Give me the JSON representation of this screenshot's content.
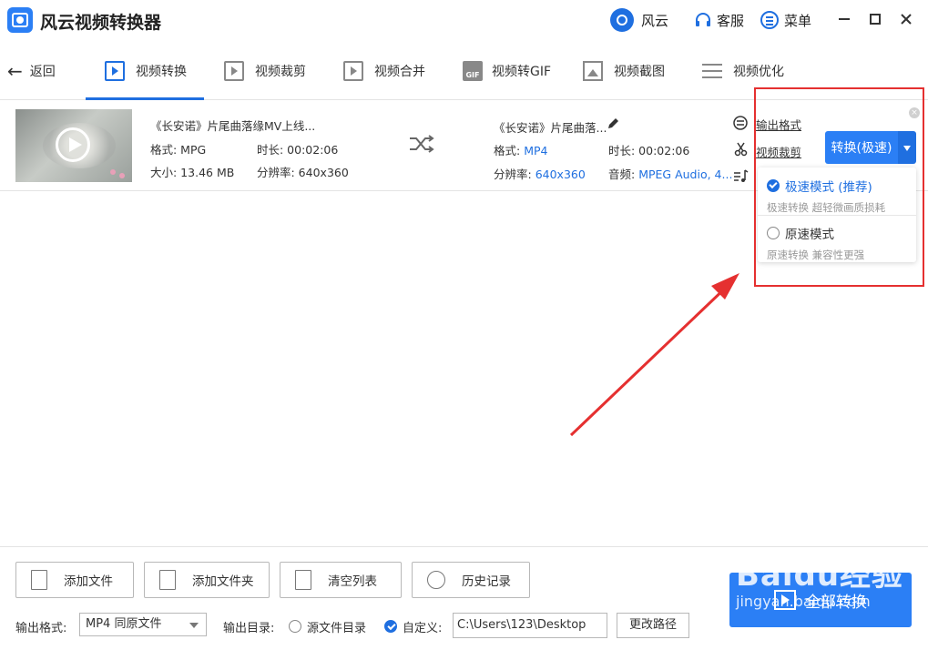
{
  "app": {
    "title": "风云视频转换器"
  },
  "titlebar": {
    "fengyun": "风云",
    "service": "客服",
    "menu": "菜单"
  },
  "nav": {
    "back": "返回",
    "tabs": [
      {
        "label": "视频转换",
        "active": true
      },
      {
        "label": "视频裁剪"
      },
      {
        "label": "视频合并"
      },
      {
        "label": "视频转GIF"
      },
      {
        "label": "视频截图"
      },
      {
        "label": "视频优化"
      }
    ]
  },
  "file": {
    "source": {
      "name": "《长安诺》片尾曲落缘MV上线...",
      "format_label": "格式: MPG",
      "duration_label": "时长: 00:02:06",
      "size_label": "大小: 13.46 MB",
      "resolution_label": "分辨率: 640x360"
    },
    "output": {
      "name": "《长安诺》片尾曲落...",
      "format_key": "格式: ",
      "format_val": "MP4",
      "duration_label": "时长: 00:02:06",
      "resolution_key": "分辨率: ",
      "resolution_val": "640x360",
      "audio_key": "音频: ",
      "audio_val": "MPEG Audio, 4..."
    },
    "links": {
      "output_format": "输出格式",
      "video_crop": "视频裁剪"
    },
    "convert_button": "转换(极速)"
  },
  "dropdown": {
    "items": [
      {
        "title": "极速模式 (推荐)",
        "subtitle": "极速转换 超轻微画质损耗",
        "checked": true
      },
      {
        "title": "原速模式",
        "subtitle": "原速转换 兼容性更强",
        "checked": false
      }
    ]
  },
  "footer": {
    "add_file": "添加文件",
    "add_folder": "添加文件夹",
    "clear_list": "清空列表",
    "history": "历史记录",
    "convert_all": "全部转换",
    "output_format_label": "输出格式:",
    "output_format_value": "MP4 同原文件",
    "output_dir_label": "输出目录:",
    "source_dir": "源文件目录",
    "custom": "自定义:",
    "path": "C:\\Users\\123\\Desktop",
    "change_path": "更改路径"
  },
  "watermark": {
    "main": "Baidu经验",
    "sub": "jingyan.baidu.com"
  },
  "colors": {
    "accent": "#2b7ff5",
    "highlight": "#e53030"
  }
}
